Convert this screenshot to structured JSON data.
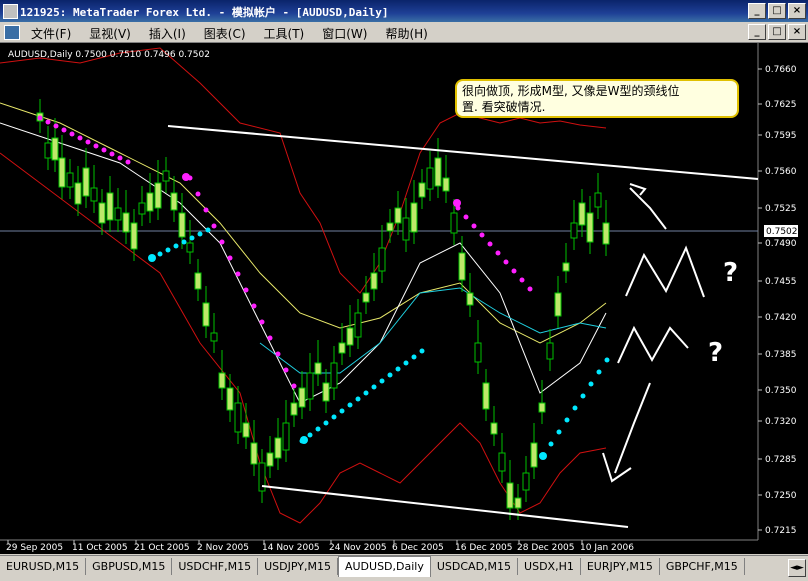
{
  "window": {
    "title": "121925: MetaTrader    Forex Ltd. - 模拟帐户 - [AUDUSD,Daily]",
    "buttons": [
      "_",
      "□",
      "×"
    ]
  },
  "menu": {
    "items": [
      "文件(F)",
      "显视(V)",
      "插入(I)",
      "图表(C)",
      "工具(T)",
      "窗口(W)",
      "帮助(H)"
    ],
    "mdi_buttons": [
      "_",
      "□",
      "×"
    ]
  },
  "chart": {
    "header": "AUDUSD,Daily  0.7500 0.7510 0.7496 0.7502",
    "annotation_line1": "很向做顶, 形成M型, 又像是W型的颈线位",
    "annotation_line2": "置. 看突破情况.",
    "question_marks": [
      "?",
      "?"
    ],
    "price_current": "0.7502",
    "price_labels": [
      "0.7660",
      "0.7625",
      "0.7595",
      "0.7560",
      "0.7525",
      "0.7490",
      "0.7455",
      "0.7420",
      "0.7385",
      "0.7350",
      "0.7320",
      "0.7285",
      "0.7250",
      "0.7215"
    ],
    "date_labels": [
      "29 Sep 2005",
      "11 Oct 2005",
      "21 Oct 2005",
      "2 Nov 2005",
      "14 Nov 2005",
      "24 Nov 2005",
      "6 Dec 2005",
      "16 Dec 2005",
      "28 Dec 2005",
      "10 Jan 2006"
    ],
    "colors": {
      "bull": "#bfe86a",
      "bear": "#000000",
      "wick": "#00c000",
      "bollinger": "#d01010",
      "ma_yellow": "#e8e86a",
      "ma_white": "#ffffff",
      "ma_cyan": "#20d0e0",
      "sar_magenta": "#ff20ff",
      "sar_cyan": "#00e8ff",
      "trendline": "#ffffff"
    }
  },
  "tabs": {
    "items": [
      "EURUSD,M15",
      "GBPUSD,M15",
      "USDCHF,M15",
      "USDJPY,M15",
      "AUDUSD,Daily",
      "USDCAD,M15",
      "USDX,H1",
      "EURJPY,M15",
      "GBPCHF,M15"
    ],
    "active_index": 4,
    "scroll": "◄►"
  }
}
